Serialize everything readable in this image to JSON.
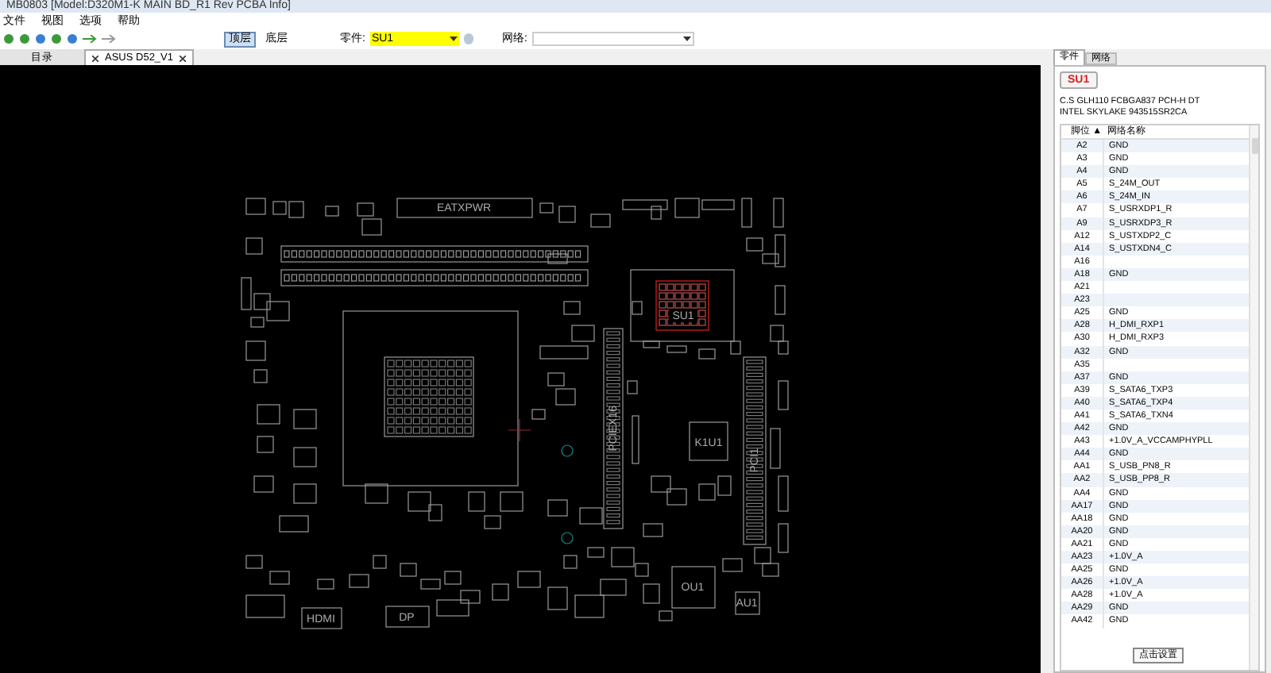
{
  "window": {
    "title": "MB0803 [Model:D320M1-K MAIN BD_R1 Rev PCBA Info]"
  },
  "menu": [
    "文件",
    "视图",
    "选项",
    "帮助"
  ],
  "toolbar": {
    "layers": [
      {
        "label": "顶层",
        "selected": true
      },
      {
        "label": "底层",
        "selected": false
      }
    ],
    "part_label": "零件:",
    "part_value": "SU1",
    "net_label": "网络:"
  },
  "doc_tabs": [
    {
      "label": "目录",
      "selected": false,
      "closable": false
    },
    {
      "label": "ASUS D52_V1",
      "selected": true,
      "closable": true
    }
  ],
  "board": {
    "labels": [
      {
        "kind": "h",
        "text": "EATXPWR"
      },
      {
        "kind": "v",
        "text": "PCIEX16"
      },
      {
        "kind": "h",
        "text": "SU1"
      },
      {
        "kind": "h",
        "text": "K1U1"
      },
      {
        "kind": "v",
        "text": "PCI1"
      },
      {
        "kind": "h",
        "text": "OU1"
      },
      {
        "kind": "h",
        "text": "AU1"
      },
      {
        "kind": "h",
        "text": "HDMI"
      },
      {
        "kind": "h",
        "text": "DP"
      }
    ]
  },
  "panel": {
    "tabs": [
      {
        "label": "零件",
        "selected": true
      },
      {
        "label": "网络",
        "selected": false
      }
    ],
    "part_button": "SU1",
    "description": [
      "C.S GLH110 FCBGA837 PCH-H DT",
      "INTEL SKYLAKE 943515SR2CA"
    ],
    "columns": [
      "脚位 ▲",
      "网络名称"
    ],
    "rows": [
      [
        "A2",
        "GND"
      ],
      [
        "A3",
        "GND"
      ],
      [
        "A4",
        "GND"
      ],
      [
        "A5",
        "S_24M_OUT"
      ],
      [
        "A6",
        "S_24M_IN"
      ],
      [
        "A7",
        "S_USRXDP1_R"
      ],
      [
        "A9",
        "S_USRXDP3_R"
      ],
      [
        "A12",
        "S_USTXDP2_C"
      ],
      [
        "A14",
        "S_USTXDN4_C"
      ],
      [
        "A16",
        ""
      ],
      [
        "A18",
        "GND"
      ],
      [
        "A21",
        ""
      ],
      [
        "A23",
        ""
      ],
      [
        "A25",
        "GND"
      ],
      [
        "A28",
        "H_DMI_RXP1"
      ],
      [
        "A30",
        "H_DMI_RXP3"
      ],
      [
        "A32",
        "GND"
      ],
      [
        "A35",
        ""
      ],
      [
        "A37",
        "GND"
      ],
      [
        "A39",
        "S_SATA6_TXP3"
      ],
      [
        "A40",
        "S_SATA6_TXP4"
      ],
      [
        "A41",
        "S_SATA6_TXN4"
      ],
      [
        "A42",
        "GND"
      ],
      [
        "A43",
        "+1.0V_A_VCCAMPHYPLL"
      ],
      [
        "A44",
        "GND"
      ],
      [
        "AA1",
        "S_USB_PN8_R"
      ],
      [
        "AA2",
        "S_USB_PP8_R"
      ],
      [
        "AA4",
        "GND"
      ],
      [
        "AA17",
        "GND"
      ],
      [
        "AA18",
        "GND"
      ],
      [
        "AA20",
        "GND"
      ],
      [
        "AA21",
        "GND"
      ],
      [
        "AA23",
        "+1.0V_A"
      ],
      [
        "AA25",
        "GND"
      ],
      [
        "AA26",
        "+1.0V_A"
      ],
      [
        "AA28",
        "+1.0V_A"
      ],
      [
        "AA29",
        "GND"
      ],
      [
        "AA42",
        "GND"
      ]
    ],
    "tooltip": "点击设置"
  }
}
